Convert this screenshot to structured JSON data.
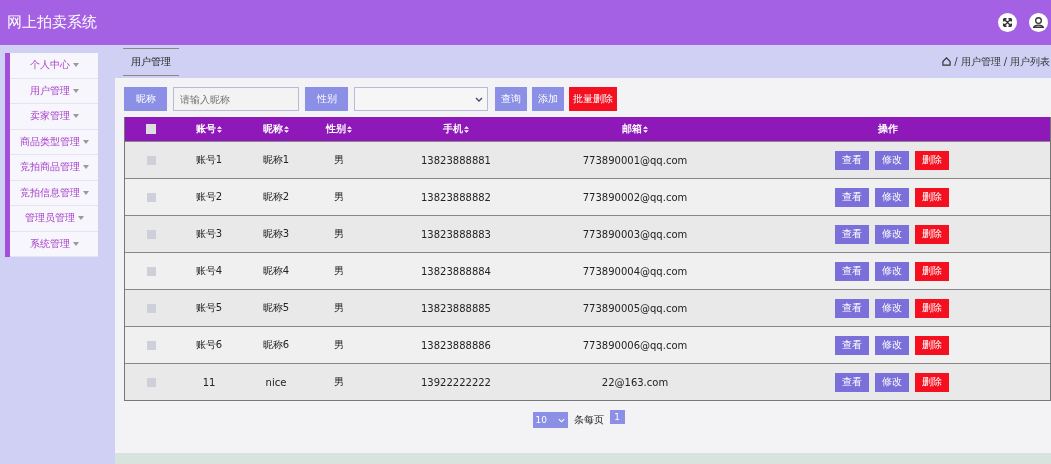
{
  "header": {
    "title": "网上拍卖系统"
  },
  "sidebar": {
    "items": [
      {
        "label": "个人中心"
      },
      {
        "label": "用户管理"
      },
      {
        "label": "卖家管理"
      },
      {
        "label": "商品类型管理"
      },
      {
        "label": "竞拍商品管理"
      },
      {
        "label": "竞拍信息管理"
      },
      {
        "label": "管理员管理"
      },
      {
        "label": "系统管理"
      }
    ]
  },
  "tabs": [
    {
      "label": "用户管理",
      "selected": true
    }
  ],
  "breadcrumb": {
    "separator": "/",
    "items": [
      "用户管理",
      "用户列表"
    ]
  },
  "search": {
    "nickname_label": "昵称",
    "nickname_placeholder": "请输入昵称",
    "gender_label": "性别",
    "buttons": [
      {
        "label": "查询",
        "kind": "normal"
      },
      {
        "label": "添加",
        "kind": "normal"
      },
      {
        "label": "批量删除",
        "kind": "danger"
      }
    ]
  },
  "table": {
    "select_all_checked": false,
    "columns": [
      "账号",
      "昵称",
      "性别",
      "手机",
      "邮箱",
      "操作"
    ],
    "rows": [
      {
        "checked": false,
        "cells": [
          "账号1",
          "昵称1",
          "男",
          "13823888881",
          "773890001@qq.com"
        ],
        "actions": [
          {
            "label": "查看",
            "kind": "normal"
          },
          {
            "label": "修改",
            "kind": "normal"
          },
          {
            "label": "删除",
            "kind": "danger"
          }
        ]
      },
      {
        "checked": false,
        "cells": [
          "账号2",
          "昵称2",
          "男",
          "13823888882",
          "773890002@qq.com"
        ],
        "actions": [
          {
            "label": "查看",
            "kind": "normal"
          },
          {
            "label": "修改",
            "kind": "normal"
          },
          {
            "label": "删除",
            "kind": "danger"
          }
        ]
      },
      {
        "checked": false,
        "cells": [
          "账号3",
          "昵称3",
          "男",
          "13823888883",
          "773890003@qq.com"
        ],
        "actions": [
          {
            "label": "查看",
            "kind": "normal"
          },
          {
            "label": "修改",
            "kind": "normal"
          },
          {
            "label": "删除",
            "kind": "danger"
          }
        ]
      },
      {
        "checked": false,
        "cells": [
          "账号4",
          "昵称4",
          "男",
          "13823888884",
          "773890004@qq.com"
        ],
        "actions": [
          {
            "label": "查看",
            "kind": "normal"
          },
          {
            "label": "修改",
            "kind": "normal"
          },
          {
            "label": "删除",
            "kind": "danger"
          }
        ]
      },
      {
        "checked": false,
        "cells": [
          "账号5",
          "昵称5",
          "男",
          "13823888885",
          "773890005@qq.com"
        ],
        "actions": [
          {
            "label": "查看",
            "kind": "normal"
          },
          {
            "label": "修改",
            "kind": "normal"
          },
          {
            "label": "删除",
            "kind": "danger"
          }
        ]
      },
      {
        "checked": false,
        "cells": [
          "账号6",
          "昵称6",
          "男",
          "13823888886",
          "773890006@qq.com"
        ],
        "actions": [
          {
            "label": "查看",
            "kind": "normal"
          },
          {
            "label": "修改",
            "kind": "normal"
          },
          {
            "label": "删除",
            "kind": "danger"
          }
        ]
      },
      {
        "checked": false,
        "cells": [
          "11",
          "nice",
          "男",
          "13922222222",
          "22@163.com"
        ],
        "actions": [
          {
            "label": "查看",
            "kind": "normal"
          },
          {
            "label": "修改",
            "kind": "normal"
          },
          {
            "label": "删除",
            "kind": "danger"
          }
        ]
      }
    ]
  },
  "pagination": {
    "page_size": "10",
    "page_size_label": "条每页",
    "pages": [
      {
        "label": "1",
        "selected": true
      }
    ]
  }
}
